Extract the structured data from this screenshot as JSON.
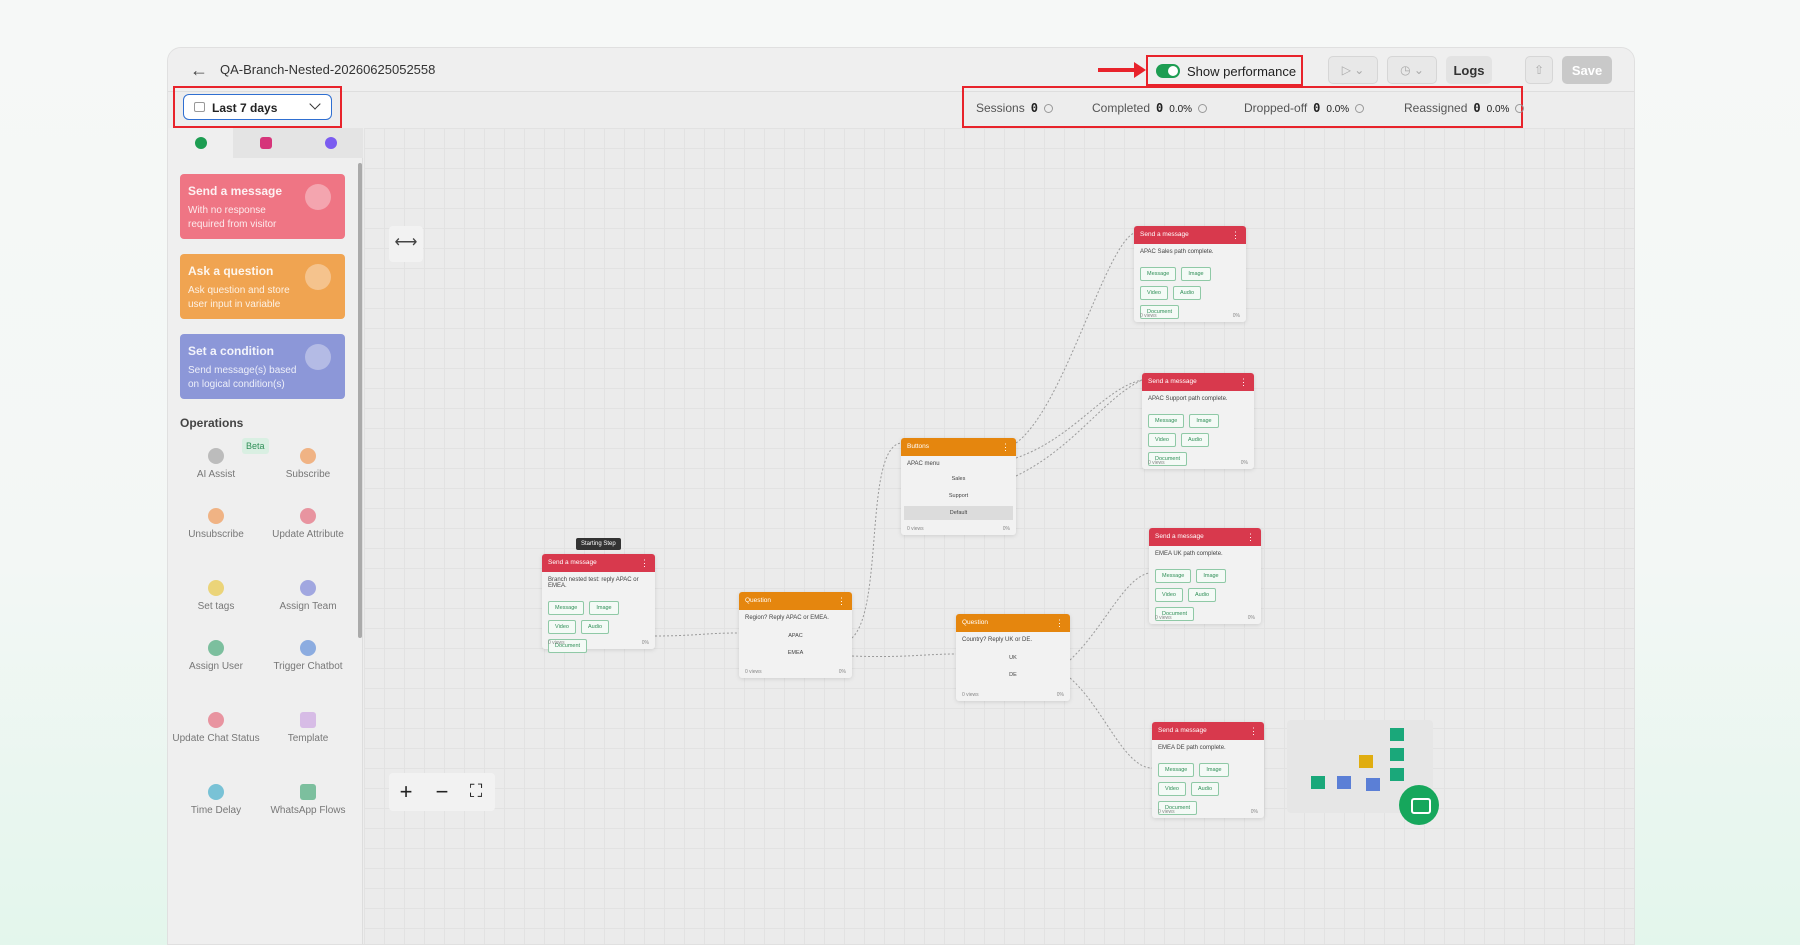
{
  "header": {
    "title": "QA-Branch-Nested-20260625052558",
    "show_performance_label": "Show performance",
    "logs_label": "Logs",
    "save_label": "Save"
  },
  "filter": {
    "date_range": "Last 7 days"
  },
  "stats": [
    {
      "label": "Sessions",
      "value": "0"
    },
    {
      "label": "Completed",
      "value": "0",
      "pct": "0.0%"
    },
    {
      "label": "Dropped-off",
      "value": "0",
      "pct": "0.0%"
    },
    {
      "label": "Reassigned",
      "value": "0",
      "pct": "0.0%"
    }
  ],
  "colors": {
    "send_message": "#d8394d",
    "question": "#e5860e",
    "condition": "#5b6bbf",
    "accent": "#1d9d52",
    "highlight": "#e8232b"
  },
  "sidebar": {
    "cards": [
      {
        "title": "Send a message",
        "desc": "With no response required from visitor"
      },
      {
        "title": "Ask a question",
        "desc": "Ask question and store user input in variable"
      },
      {
        "title": "Set a condition",
        "desc": "Send message(s) based on logical condition(s)"
      }
    ],
    "operations_title": "Operations",
    "beta_label": "Beta",
    "operations": [
      "AI Assist",
      "Subscribe",
      "Unsubscribe",
      "Update Attribute",
      "Set tags",
      "Assign Team",
      "Assign User",
      "Trigger Chatbot",
      "Update Chat Status",
      "Template",
      "Time Delay",
      "WhatsApp Flows"
    ]
  },
  "nodes": {
    "starting_step": "Starting Step",
    "send_title": "Send a message",
    "question_title": "Question",
    "buttons_title": "Buttons",
    "media_buttons": [
      "Message",
      "Image",
      "Video",
      "Audio",
      "Document"
    ],
    "footer_views": "0 views",
    "footer_pct": "0%",
    "start_text": "Branch nested test: reply APAC or EMEA.",
    "q1_text": "Region? Reply APAC or EMEA.",
    "q1_options": [
      "APAC",
      "EMEA"
    ],
    "menu_text": "APAC menu",
    "menu_options": [
      "Sales",
      "Support",
      "Default"
    ],
    "q2_text": "Country? Reply UK or DE.",
    "q2_options": [
      "UK",
      "DE"
    ],
    "end_texts": [
      "APAC Sales path complete.",
      "APAC Support path complete.",
      "EMEA UK path complete.",
      "EMEA DE path complete."
    ]
  }
}
